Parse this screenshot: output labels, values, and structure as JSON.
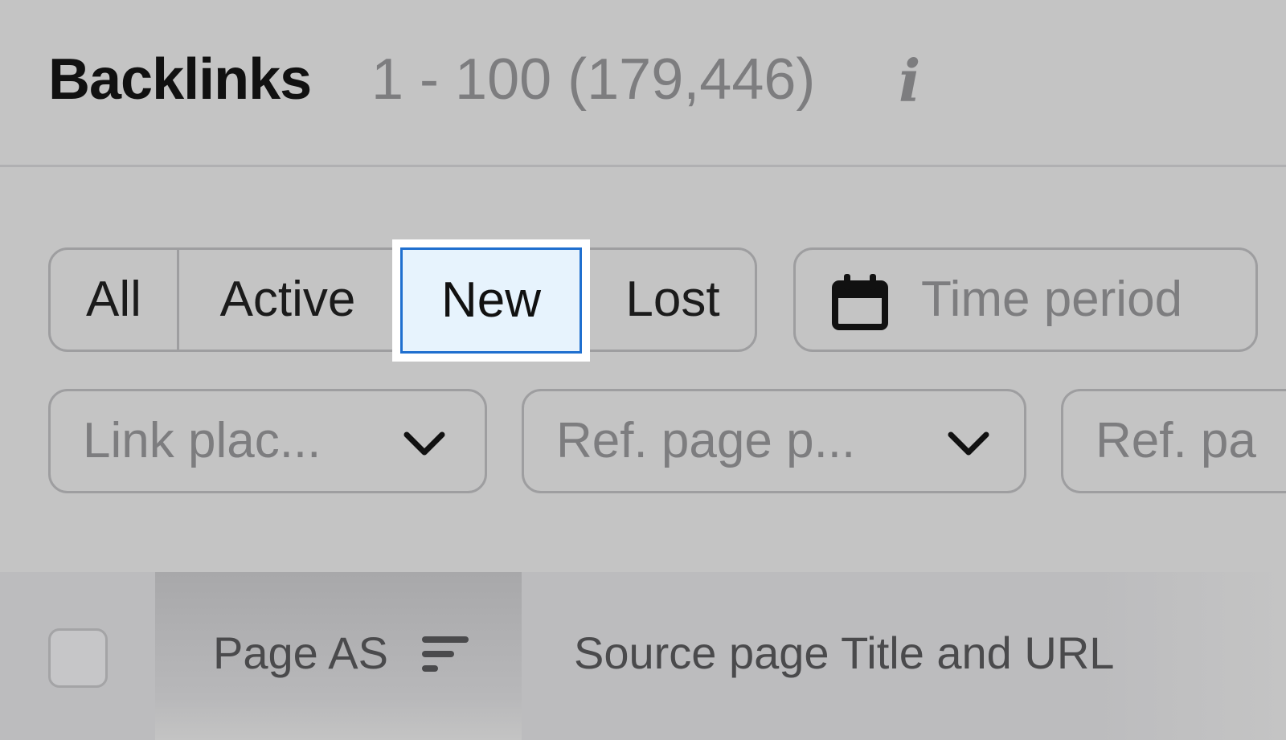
{
  "header": {
    "title": "Backlinks",
    "count": "1 - 100 (179,446)",
    "info_icon": "info-icon"
  },
  "filters": {
    "segments": [
      {
        "label": "All",
        "selected": false
      },
      {
        "label": "Active",
        "selected": false
      },
      {
        "label": "New",
        "selected": true
      },
      {
        "label": "Lost",
        "selected": false
      }
    ],
    "time_period": {
      "label": "Time period",
      "icon": "calendar-icon"
    },
    "dropdowns": [
      {
        "label": "Link plac...",
        "icon": "chevron-down-icon"
      },
      {
        "label": "Ref. page p...",
        "icon": "chevron-down-icon"
      },
      {
        "label": "Ref. pa",
        "icon": ""
      }
    ]
  },
  "table": {
    "columns": [
      {
        "label": "Page AS",
        "icon": "sort-icon"
      },
      {
        "label": "Source page Title and URL"
      }
    ]
  },
  "colors": {
    "selected_border": "#1f6fcf",
    "selected_fill": "#e7f3fd",
    "overlay": "#c4c4c4"
  }
}
